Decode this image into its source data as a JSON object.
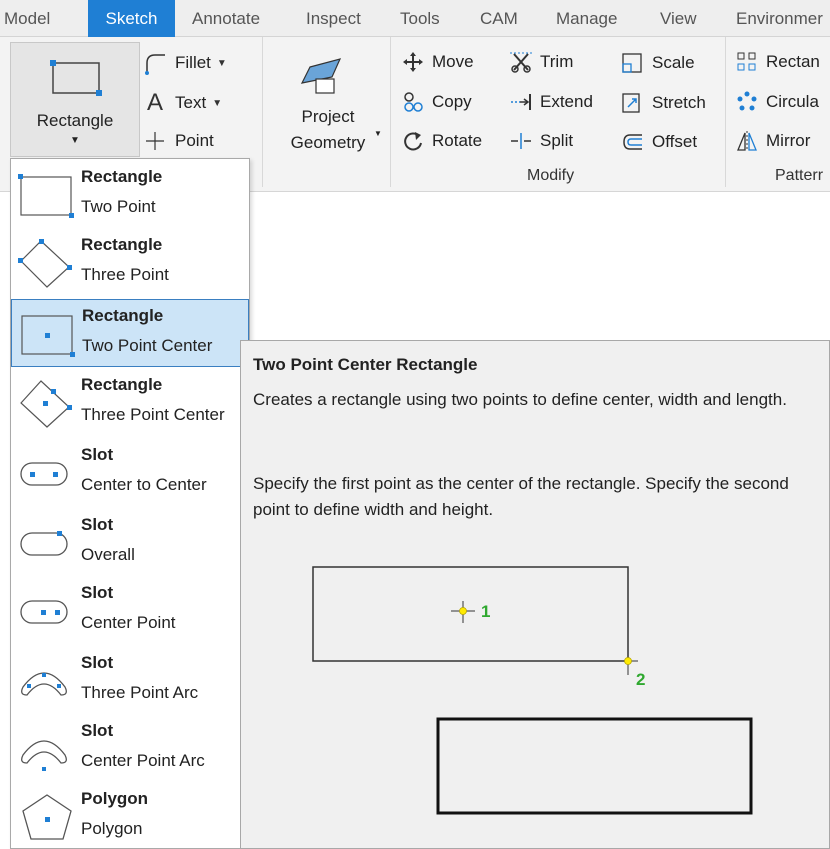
{
  "tabs": [
    {
      "label": "Model",
      "active": false
    },
    {
      "label": "Sketch",
      "active": true
    },
    {
      "label": "Annotate",
      "active": false
    },
    {
      "label": "Inspect",
      "active": false
    },
    {
      "label": "Tools",
      "active": false
    },
    {
      "label": "CAM",
      "active": false
    },
    {
      "label": "Manage",
      "active": false
    },
    {
      "label": "View",
      "active": false
    },
    {
      "label": "Environmer",
      "active": false
    }
  ],
  "ribbon": {
    "rectangle_label": "Rectangle",
    "fillet_label": "Fillet",
    "text_label": "Text",
    "point_label": "Point",
    "project_label_1": "Project",
    "project_label_2": "Geometry",
    "move_label": "Move",
    "copy_label": "Copy",
    "rotate_label": "Rotate",
    "trim_label": "Trim",
    "extend_label": "Extend",
    "split_label": "Split",
    "scale_label": "Scale",
    "stretch_label": "Stretch",
    "offset_label": "Offset",
    "rectangular_label": "Rectan",
    "circular_label": "Circula",
    "mirror_label": "Mirror",
    "modify_group": "Modify",
    "pattern_group": "Patterr"
  },
  "dropdown": {
    "items": [
      {
        "title": "Rectangle",
        "subtitle": "Two Point",
        "icon": "rectangle-two-point-icon"
      },
      {
        "title": "Rectangle",
        "subtitle": "Three Point",
        "icon": "rectangle-three-point-icon"
      },
      {
        "title": "Rectangle",
        "subtitle": "Two Point Center",
        "icon": "rectangle-two-point-center-icon",
        "selected": true
      },
      {
        "title": "Rectangle",
        "subtitle": "Three Point Center",
        "icon": "rectangle-three-point-center-icon"
      },
      {
        "title": "Slot",
        "subtitle": "Center to Center",
        "icon": "slot-center-to-center-icon"
      },
      {
        "title": "Slot",
        "subtitle": "Overall",
        "icon": "slot-overall-icon"
      },
      {
        "title": "Slot",
        "subtitle": "Center Point",
        "icon": "slot-center-point-icon"
      },
      {
        "title": "Slot",
        "subtitle": "Three Point Arc",
        "icon": "slot-three-point-arc-icon"
      },
      {
        "title": "Slot",
        "subtitle": "Center Point Arc",
        "icon": "slot-center-point-arc-icon"
      },
      {
        "title": "Polygon",
        "subtitle": "Polygon",
        "icon": "polygon-icon"
      }
    ]
  },
  "tooltip": {
    "title": "Two Point Center Rectangle",
    "description": "Creates a rectangle using two points to define center, width and length.",
    "instructions": "Specify the first point as the center of the rectangle. Specify the second point to define width and height.",
    "point1_label": "1",
    "point2_label": "2"
  },
  "colors": {
    "tab_active": "#1f7fd4",
    "selection_bg": "#cce4f7",
    "selection_border": "#3a7fc1",
    "icon_blue": "#1f7fd4",
    "point_green": "#2fa82f",
    "point_yellow": "#ffea00"
  }
}
